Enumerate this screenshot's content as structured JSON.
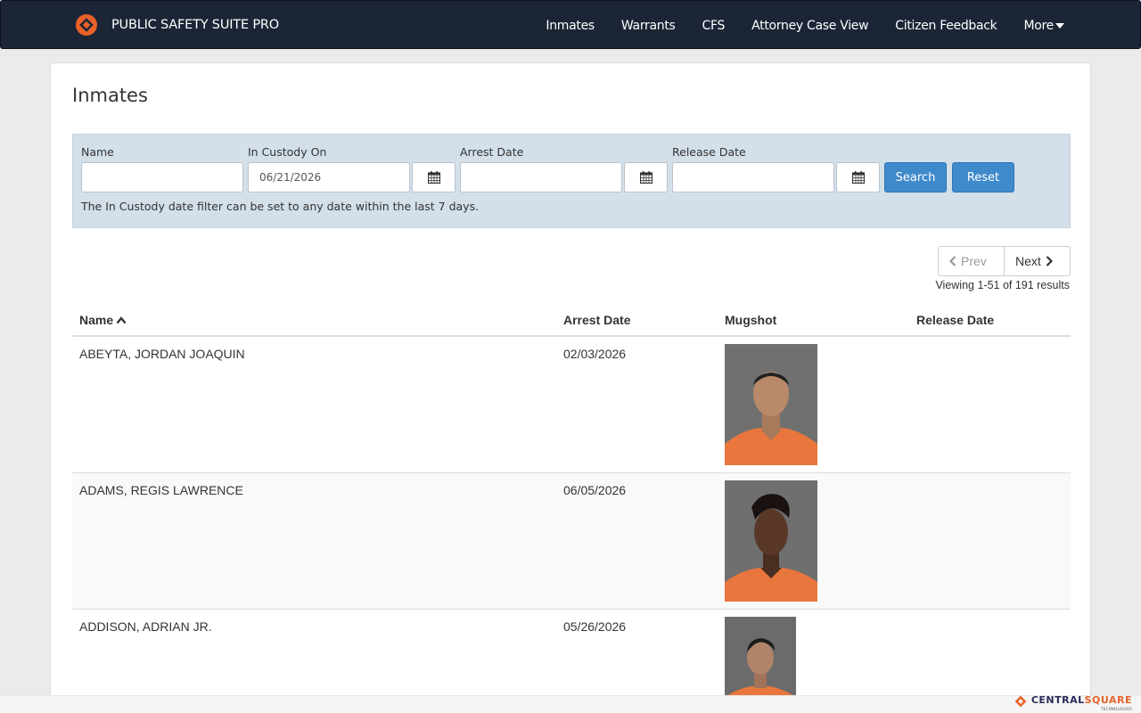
{
  "app": {
    "name": "PUBLIC SAFETY SUITE PRO"
  },
  "nav": {
    "items": [
      "Inmates",
      "Warrants",
      "CFS",
      "Attorney Case View",
      "Citizen Feedback"
    ],
    "more_label": "More"
  },
  "page": {
    "title": "Inmates"
  },
  "filters": {
    "name_label": "Name",
    "name_value": "",
    "custody_label": "In Custody On",
    "custody_value": "06/21/2026",
    "arrest_label": "Arrest Date",
    "arrest_value": "",
    "release_label": "Release Date",
    "release_value": "",
    "search_label": "Search",
    "reset_label": "Reset",
    "note": "The In Custody date filter can be set to any date within the last 7 days."
  },
  "pagination": {
    "prev_label": "Prev",
    "next_label": "Next",
    "summary": "Viewing 1-51 of 191 results"
  },
  "table": {
    "columns": [
      "Name",
      "Arrest Date",
      "Mugshot",
      "Release Date"
    ],
    "rows": [
      {
        "name": "ABEYTA, JORDAN JOAQUIN",
        "arrest_date": "02/03/2026",
        "release_date": ""
      },
      {
        "name": "ADAMS, REGIS LAWRENCE",
        "arrest_date": "06/05/2026",
        "release_date": ""
      },
      {
        "name": "ADDISON, ADRIAN JR.",
        "arrest_date": "05/26/2026",
        "release_date": ""
      }
    ]
  },
  "footer": {
    "brand_part1": "CENTRAL",
    "brand_part2": "SQUARE",
    "brand_sub": "TECHNOLOGIES"
  },
  "colors": {
    "navbar": "#1b2536",
    "accent": "#3f8acb",
    "brand_orange": "#e8622a",
    "filter_bg": "#d3dfe9",
    "mugshot_bg": "#6b6b6b",
    "jumpsuit": "#e8763d"
  }
}
